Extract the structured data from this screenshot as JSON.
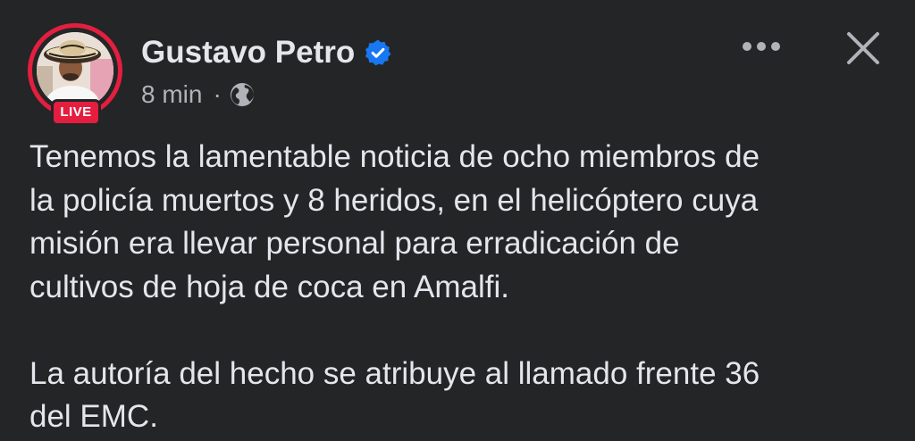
{
  "post": {
    "author": {
      "name": "Gustavo Petro",
      "verified": true,
      "live_label": "LIVE",
      "avatar_icon": "profile-photo-avatar"
    },
    "meta": {
      "timestamp": "8 min",
      "separator": "·",
      "audience_icon": "globe-icon"
    },
    "controls": {
      "more_icon": "more-options-icon",
      "close_icon": "close-icon"
    },
    "paragraphs": [
      "Tenemos la lamentable noticia de ocho miembros de\nla policía muertos y 8 heridos, en el helicóptero cuya\nmisión era llevar personal para erradicación de\ncultivos de hoja de coca en Amalfi.",
      "La autoría del hecho se atribuye al llamado frente 36\ndel EMC."
    ]
  },
  "colors": {
    "background": "#242526",
    "primary_text": "#e4e6eb",
    "secondary_text": "#b0b3b8",
    "live_red": "#e41e3f",
    "verified_blue": "#1877f2"
  }
}
